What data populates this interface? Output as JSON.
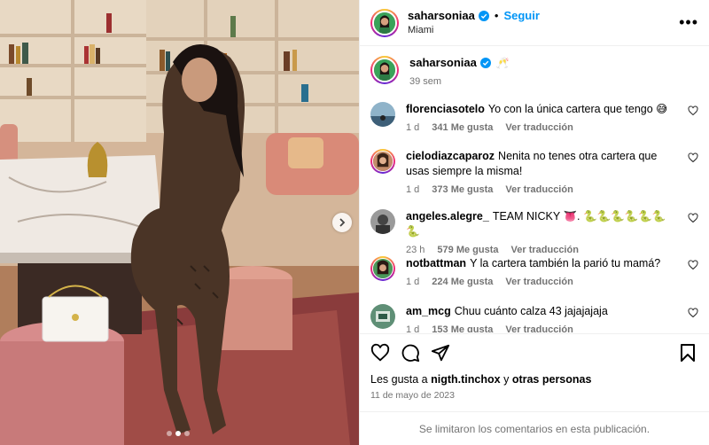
{
  "post": {
    "username": "saharsoniaa",
    "follow_label": "Seguir",
    "separator": "•",
    "location": "Miami",
    "more_icon": "more-horizontal-icon"
  },
  "caption": {
    "username": "saharsoniaa",
    "emoji": "🥂",
    "time": "39 sem"
  },
  "comments": [
    {
      "username": "florenciasotelo",
      "text": "Yo con la única cartera que tengo 😅",
      "time": "1 d",
      "likes": "341 Me gusta",
      "translate": "Ver traducción"
    },
    {
      "username": "cielodiazcaparoz",
      "text": "Nenita no tenes otra cartera que usas siempre la misma!",
      "time": "1 d",
      "likes": "373 Me gusta",
      "translate": "Ver traducción"
    },
    {
      "username": "angeles.alegre_",
      "text": "TEAM NICKY 👅. 🐍🐍🐍🐍🐍🐍🐍",
      "time": "23 h",
      "likes": "579 Me gusta",
      "translate": "Ver traducción"
    },
    {
      "username": "notbattman",
      "text": "Y la cartera también la parió tu mamá?",
      "time": "1 d",
      "likes": "224 Me gusta",
      "translate": "Ver traducción"
    },
    {
      "username": "am_mcg",
      "text": "Chuu cuánto calza 43 jajajajaja",
      "time": "1 d",
      "likes": "153 Me gusta",
      "translate": "Ver traducción"
    }
  ],
  "likes": {
    "prefix": "Les gusta a",
    "user": "nigth.tinchox",
    "connector": "y",
    "others": "otras personas"
  },
  "date": "11 de mayo de 2023",
  "comments_limited": "Se limitaron los comentarios en esta publicación.",
  "colors": {
    "accent": "#0095f6",
    "verified": "#0095f6",
    "muted": "#737373"
  },
  "icons": [
    "heart-icon",
    "comment-icon",
    "share-icon",
    "bookmark-icon",
    "verified-badge-icon",
    "chevron-right-icon"
  ]
}
